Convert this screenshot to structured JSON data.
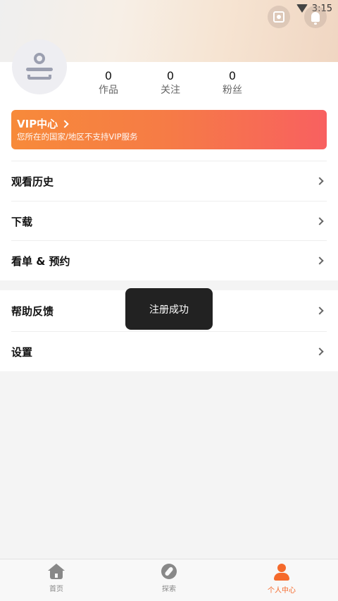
{
  "status_bar": {
    "time": "3:15"
  },
  "profile": {
    "stats": [
      {
        "value": "0",
        "label": "作品"
      },
      {
        "value": "0",
        "label": "关注"
      },
      {
        "value": "0",
        "label": "粉丝"
      }
    ]
  },
  "vip": {
    "title": "VIP中心",
    "subtitle": "您所在的国家/地区不支持VIP服务"
  },
  "menu": {
    "group1": [
      {
        "label": "观看历史"
      },
      {
        "label": "下载"
      },
      {
        "label": "看单 & 预约"
      }
    ],
    "group2": [
      {
        "label": "帮助反馈"
      },
      {
        "label": "设置"
      }
    ]
  },
  "toast": {
    "text": "注册成功"
  },
  "bottom_nav": {
    "items": [
      {
        "label": "首页",
        "icon": "home-icon"
      },
      {
        "label": "探索",
        "icon": "compass-icon"
      },
      {
        "label": "个人中心",
        "icon": "person-icon",
        "active": true
      }
    ]
  },
  "colors": {
    "accent": "#f56a2c",
    "vip_gradient_start": "#f78a3a",
    "vip_gradient_end": "#f86060"
  }
}
